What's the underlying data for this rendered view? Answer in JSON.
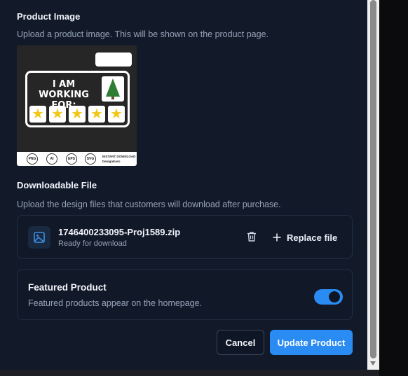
{
  "product_image": {
    "title": "Product Image",
    "description": "Upload a product image. This will be shown on the product page.",
    "preview": {
      "headline_line1": "I AM WORKING",
      "headline_line2": "FOR:",
      "star_glyph": "★",
      "formats": [
        "PNG",
        "AI",
        "EPS",
        "SVG"
      ],
      "footer_line1": "INSTANT DOWNLOAD",
      "footer_line2": "DesignKoro",
      "colors": {
        "star": "#f2c616",
        "tree": "#2f7d32"
      }
    }
  },
  "downloadable_file": {
    "title": "Downloadable File",
    "description": "Upload the design files that customers will download after purchase.",
    "file": {
      "icon": "image-file-icon",
      "name": "1746400233095-Proj1589.zip",
      "status": "Ready for download"
    },
    "delete_icon": "trash-icon",
    "replace_label": "Replace file",
    "replace_icon": "plus-icon"
  },
  "featured": {
    "title": "Featured Product",
    "description": "Featured products appear on the homepage.",
    "enabled": true
  },
  "actions": {
    "cancel_label": "Cancel",
    "update_label": "Update Product"
  },
  "colors": {
    "accent": "#2a8bf2",
    "panel_bg": "#121a2a",
    "muted_text": "#97a3b6"
  }
}
